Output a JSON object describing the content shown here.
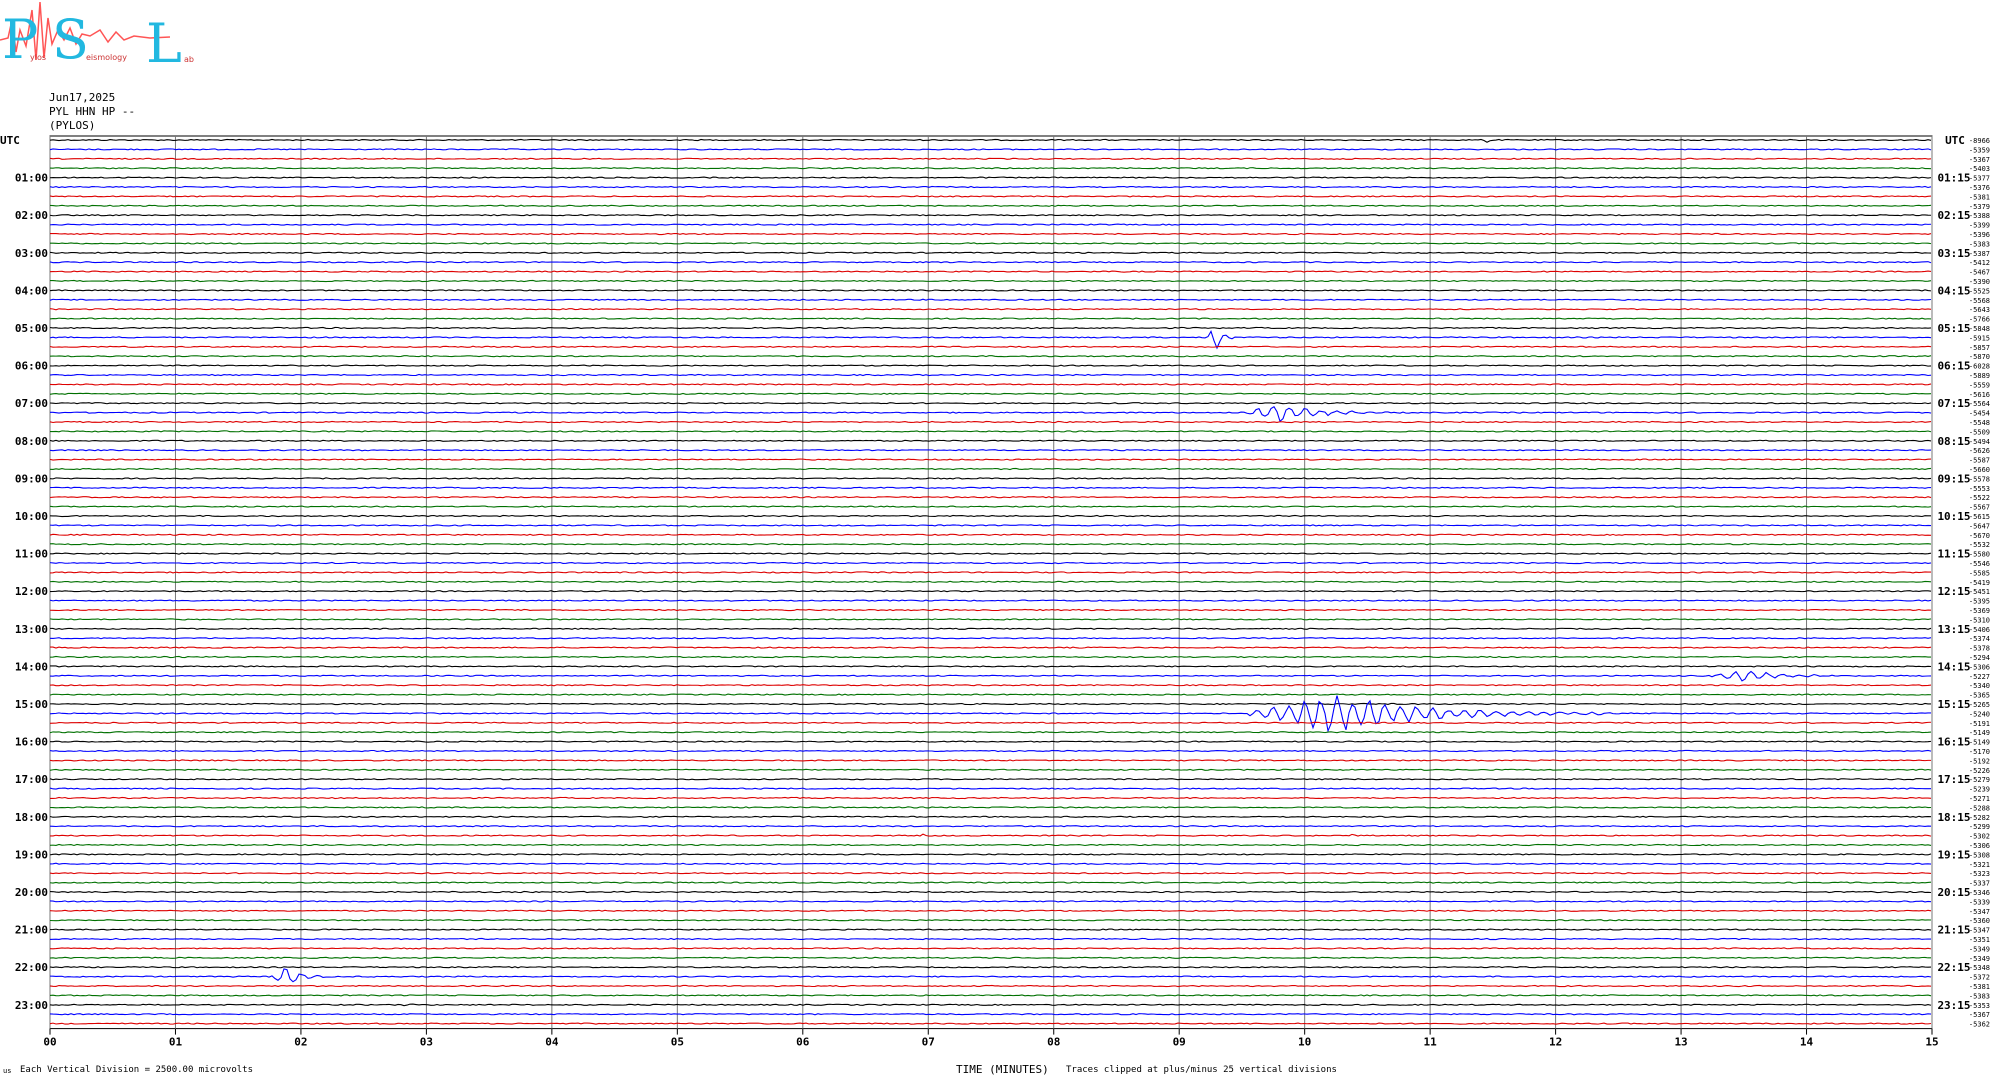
{
  "header": {
    "logo_text": "PSL",
    "logo_small": [
      "ylos",
      "eismology",
      "ab"
    ],
    "date": "Jun17,2025",
    "station": "PYL HHN HP --",
    "location": "(PYLOS)",
    "utc_left": "UTC",
    "utc_right": "UTC"
  },
  "footer": {
    "marker": "us",
    "scale": "Each Vertical Division = 2500.00 microvolts",
    "xlabel": "TIME (MINUTES)",
    "clip": "Traces clipped at plus/minus 25 vertical divisions"
  },
  "colors": {
    "trace_cycle": [
      "#000000",
      "#0000ff",
      "#dd0000",
      "#007000"
    ],
    "grid": "#777777"
  },
  "chart_data": {
    "type": "line",
    "title": "",
    "xlabel": "TIME (MINUTES)",
    "ylabel": "",
    "x_ticks": [
      "00",
      "01",
      "02",
      "03",
      "04",
      "05",
      "06",
      "07",
      "08",
      "09",
      "10",
      "11",
      "12",
      "13",
      "14",
      "15"
    ],
    "xlim": [
      0,
      15
    ],
    "grid": true,
    "left_hour_labels": [
      "01:00",
      "02:00",
      "03:00",
      "04:00",
      "05:00",
      "06:00",
      "07:00",
      "08:00",
      "09:00",
      "10:00",
      "11:00",
      "12:00",
      "13:00",
      "14:00",
      "15:00",
      "16:00",
      "17:00",
      "18:00",
      "19:00",
      "20:00",
      "21:00",
      "22:00",
      "23:00"
    ],
    "right_hour_labels": [
      "01:15",
      "02:15",
      "03:15",
      "04:15",
      "05:15",
      "06:15",
      "07:15",
      "08:15",
      "09:15",
      "10:15",
      "11:15",
      "12:15",
      "13:15",
      "14:15",
      "15:15",
      "16:15",
      "17:15",
      "18:15",
      "19:15",
      "20:15",
      "21:15",
      "22:15",
      "23:15"
    ],
    "trace_offsets": [
      "-8966",
      "-5359",
      "-5367",
      "-5403",
      "-5377",
      "-5376",
      "-5381",
      "-5379",
      "-5388",
      "-5399",
      "-5396",
      "-5383",
      "-5387",
      "-5412",
      "-5467",
      "-5390",
      "-5525",
      "-5568",
      "-5643",
      "-5766",
      "-5848",
      "-5915",
      "-5857",
      "-5870",
      "-6028",
      "-5889",
      "-5559",
      "-5616",
      "-5564",
      "-5454",
      "-5548",
      "-5509",
      "-5494",
      "-5626",
      "-5587",
      "-5660",
      "-5578",
      "-5553",
      "-5522",
      "-5567",
      "-5615",
      "-5647",
      "-5670",
      "-5532",
      "-5580",
      "-5546",
      "-5585",
      "-5419",
      "-5451",
      "-5395",
      "-5369",
      "-5310",
      "-5406",
      "-5374",
      "-5378",
      "-5294",
      "-5306",
      "-5227",
      "-5340",
      "-5365",
      "-5265",
      "-5240",
      "-5191",
      "-5149",
      "-5149",
      "-5170",
      "-5192",
      "-5226",
      "-5279",
      "-5239",
      "-5271",
      "-5288",
      "-5282",
      "-5299",
      "-5302",
      "-5306",
      "-5308",
      "-5321",
      "-5323",
      "-5337",
      "-5346",
      "-5339",
      "-5347",
      "-5360",
      "-5347",
      "-5351",
      "-5349",
      "-5349",
      "-5348",
      "-5372",
      "-5381",
      "-5383",
      "-5353",
      "-5367",
      "-5362"
    ],
    "events": [
      {
        "trace": 0,
        "minute": 11.45,
        "amplitude": 0.3,
        "duration": 0.05,
        "color_index": 0
      },
      {
        "trace": 21,
        "minute": 9.28,
        "amplitude": 1.8,
        "duration": 0.15,
        "color_index": 1
      },
      {
        "trace": 29,
        "minute": 9.8,
        "amplitude": 0.9,
        "duration": 0.9,
        "color_index": 2
      },
      {
        "trace": 57,
        "minute": 13.5,
        "amplitude": 0.6,
        "duration": 0.8,
        "color_index": 2
      },
      {
        "trace": 61,
        "minute": 10.25,
        "amplitude": 1.8,
        "duration": 2.2,
        "color_index": 1
      },
      {
        "trace": 74,
        "minute": 6.95,
        "amplitude": 0.3,
        "duration": 0.05,
        "color_index": 0
      },
      {
        "trace": 74,
        "minute": 10.38,
        "amplitude": 0.3,
        "duration": 0.05,
        "color_index": 0
      },
      {
        "trace": 89,
        "minute": 1.88,
        "amplitude": 1.2,
        "duration": 0.35,
        "color_index": 2
      },
      {
        "trace": 92,
        "minute": 2.8,
        "amplitude": 0.3,
        "duration": 0.1,
        "color_index": 0
      }
    ]
  }
}
